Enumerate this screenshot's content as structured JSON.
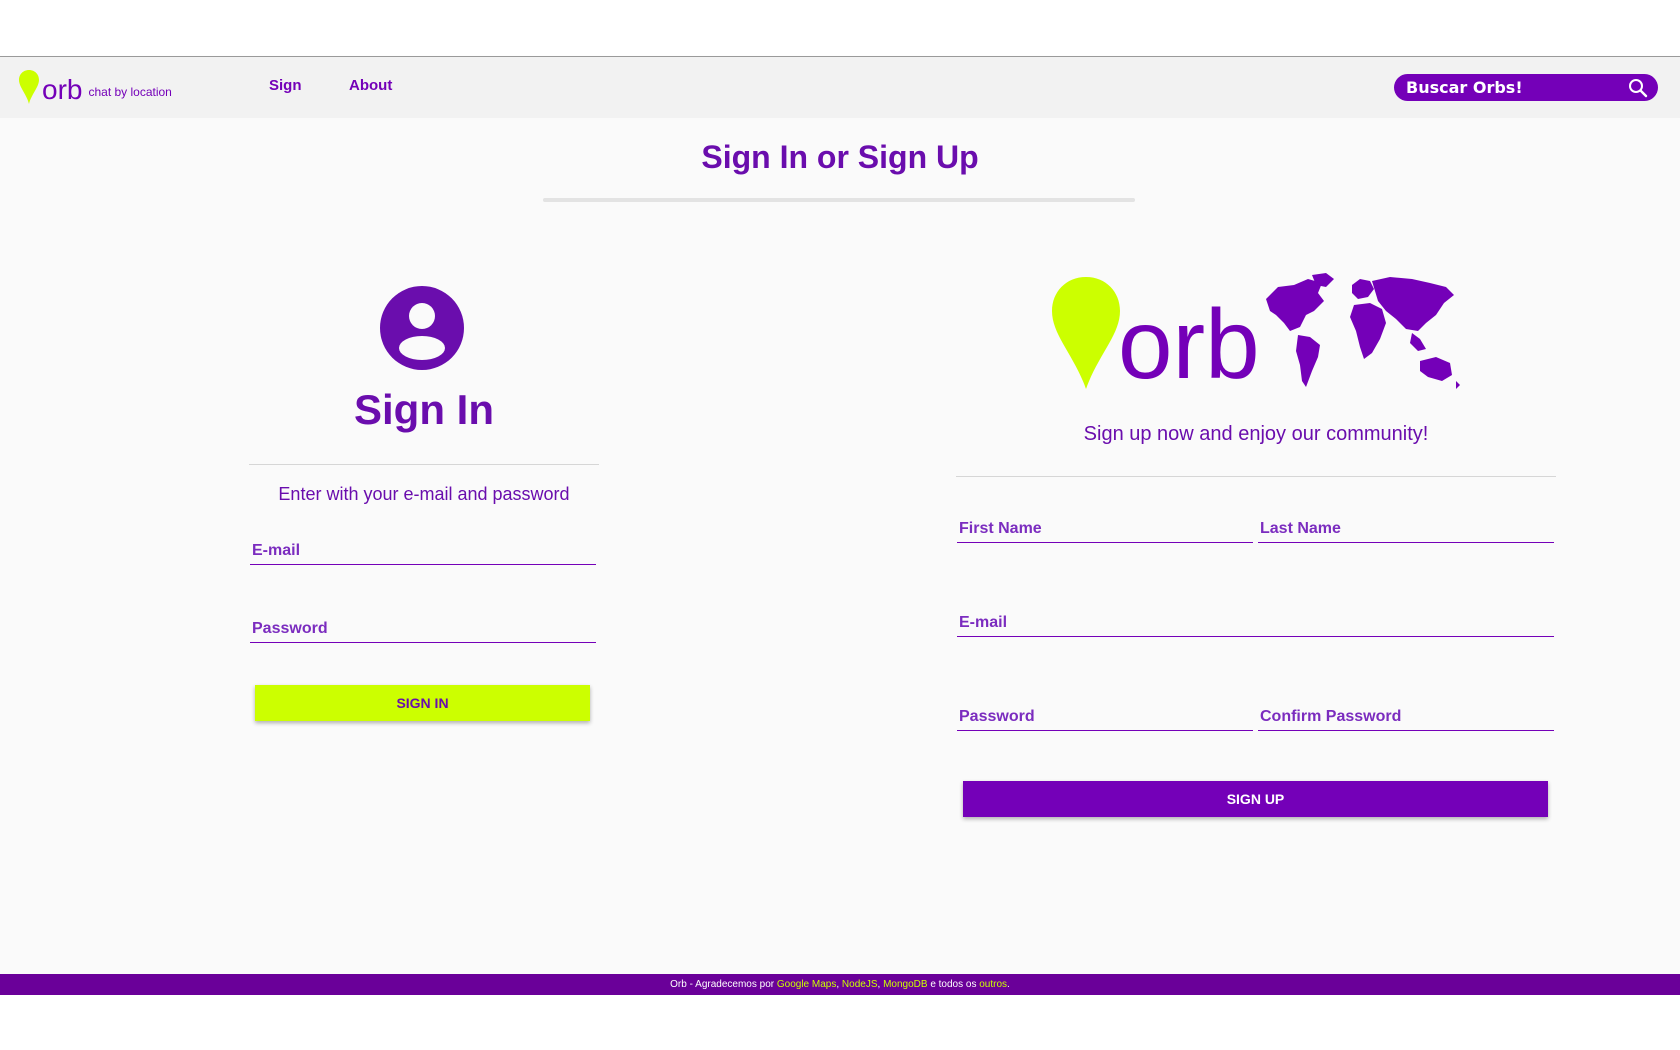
{
  "nav": {
    "logo_text": "orb",
    "tagline": "chat by location",
    "links": [
      "Sign",
      "About"
    ],
    "search_placeholder": "Buscar Orbs!"
  },
  "page": {
    "title": "Sign In or Sign Up"
  },
  "signin": {
    "title": "Sign In",
    "subtitle": "Enter with your e-mail and password",
    "email_placeholder": "E-mail",
    "password_placeholder": "Password",
    "button_label": "SIGN IN"
  },
  "signup": {
    "brand_text": "orb",
    "subtitle": "Sign up now and enjoy our community!",
    "first_name_placeholder": "First Name",
    "last_name_placeholder": "Last Name",
    "email_placeholder": "E-mail",
    "password_placeholder": "Password",
    "confirm_password_placeholder": "Confirm Password",
    "button_label": "SIGN UP"
  },
  "footer": {
    "prefix": "Orb - Agradecemos por",
    "link1": "Google Maps",
    "sep1": ",",
    "link2": "NodeJS",
    "sep2": ",",
    "link3": "MongoDB",
    "mid": "e todos os",
    "link4": "outros",
    "end": "."
  },
  "icons": {
    "logo": "location-pin-icon",
    "search": "search-icon",
    "avatar": "account-circle-icon",
    "world": "world-map-icon"
  },
  "colors": {
    "primary": "#7400b8",
    "accent": "#ccff00",
    "footer": "#6a0099"
  }
}
